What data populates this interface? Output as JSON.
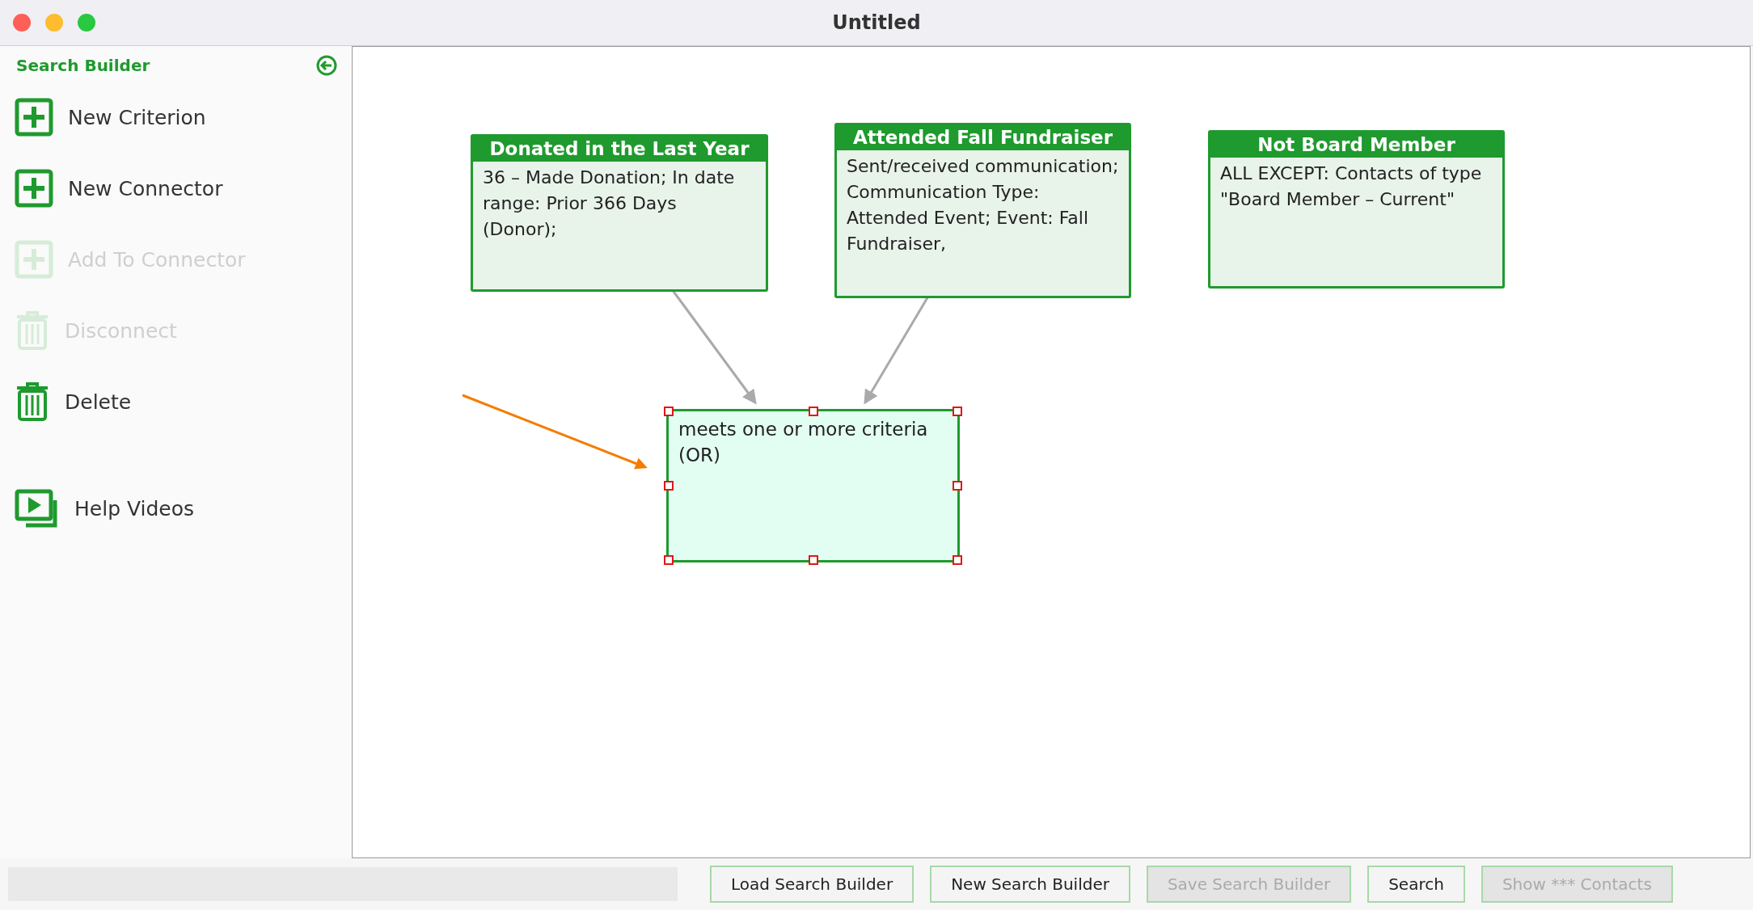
{
  "window": {
    "title": "Untitled"
  },
  "sidebar": {
    "title": "Search Builder",
    "items": [
      {
        "label": "New Criterion",
        "kind": "plus",
        "disabled": false
      },
      {
        "label": "New Connector",
        "kind": "plus",
        "disabled": false
      },
      {
        "label": "Add To Connector",
        "kind": "plus",
        "disabled": true
      },
      {
        "label": "Disconnect",
        "kind": "trash",
        "disabled": true
      },
      {
        "label": "Delete",
        "kind": "trash",
        "disabled": false
      },
      {
        "label": "Help Videos",
        "kind": "video",
        "disabled": false
      }
    ]
  },
  "canvas": {
    "criteria": [
      {
        "title": "Donated in the Last Year",
        "body": "36 – Made Donation; In date range: Prior 366 Days (Donor);"
      },
      {
        "title": "Attended Fall Fundraiser",
        "body": "Sent/received communication; Communication Type: Attended Event; Event: Fall Fundraiser,"
      },
      {
        "title": "Not Board Member",
        "body": "ALL EXCEPT: Contacts of type \"Board Member – Current\""
      }
    ],
    "connector": {
      "text": "meets one or more criteria (OR)",
      "selected": true
    }
  },
  "buttons": [
    {
      "label": "Load Search Builder",
      "disabled": false
    },
    {
      "label": "New Search Builder",
      "disabled": false
    },
    {
      "label": "Save Search Builder",
      "disabled": true
    },
    {
      "label": "Search",
      "disabled": false
    },
    {
      "label": "Show *** Contacts",
      "disabled": true
    }
  ]
}
